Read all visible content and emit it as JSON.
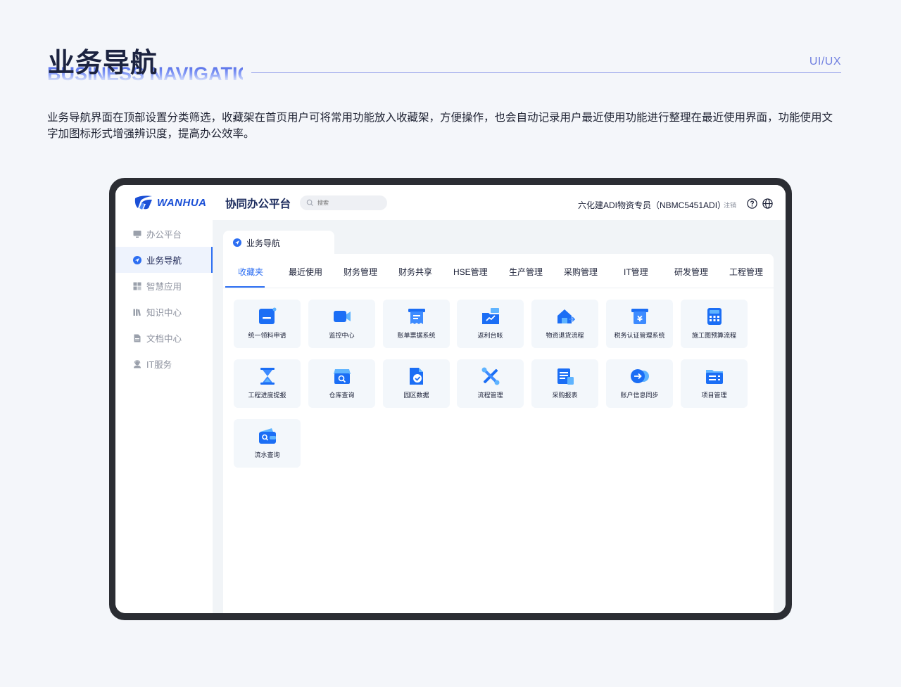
{
  "header": {
    "title": "业务导航",
    "subtitle": "BUSINESS NAVIGATIO",
    "tag": "UI/UX",
    "description": "业务导航界面在顶部设置分类筛选，收藏架在首页用户可将常用功能放入收藏架，方便操作，也会自动记录用户最近使用功能进行整理在最近使用界面，功能使用文字加图标形式增强辨识度，提高办公效率。"
  },
  "app": {
    "logo_text": "WANHUA",
    "platform_title": "协同办公平台",
    "search_placeholder": "搜索",
    "user": "六化建ADI物资专员（NBMC5451ADI）",
    "logout": "注销"
  },
  "sidebar": {
    "items": [
      {
        "label": "办公平台",
        "icon": "monitor-icon"
      },
      {
        "label": "业务导航",
        "icon": "navigation-icon",
        "active": true
      },
      {
        "label": "智慧应用",
        "icon": "apps-grid-icon"
      },
      {
        "label": "知识中心",
        "icon": "books-icon"
      },
      {
        "label": "文档中心",
        "icon": "document-icon"
      },
      {
        "label": "IT服务",
        "icon": "headset-icon"
      }
    ]
  },
  "content": {
    "tab_label": "业务导航",
    "categories": [
      "收藏夹",
      "最近使用",
      "财务管理",
      "财务共享",
      "HSE管理",
      "生产管理",
      "采购管理",
      "IT管理",
      "研发管理",
      "工程管理"
    ],
    "active_category": "收藏夹",
    "tiles": [
      {
        "label": "统一领料申请",
        "icon": "requisition-icon"
      },
      {
        "label": "监控中心",
        "icon": "camera-icon"
      },
      {
        "label": "账单票据系统",
        "icon": "receipt-icon"
      },
      {
        "label": "返利台帐",
        "icon": "rebate-folder-icon"
      },
      {
        "label": "物资退货流程",
        "icon": "return-goods-icon"
      },
      {
        "label": "税务认证管理系统",
        "icon": "tax-yen-icon"
      },
      {
        "label": "施工图预算流程",
        "icon": "calculator-icon"
      },
      {
        "label": "工程进度提报",
        "icon": "hourglass-icon"
      },
      {
        "label": "仓库查询",
        "icon": "warehouse-search-icon"
      },
      {
        "label": "园区数据",
        "icon": "park-data-icon"
      },
      {
        "label": "流程管理",
        "icon": "tools-icon"
      },
      {
        "label": "采购报表",
        "icon": "purchase-report-icon"
      },
      {
        "label": "账户信息同步",
        "icon": "account-sync-icon"
      },
      {
        "label": "项目管理",
        "icon": "project-folder-icon"
      },
      {
        "label": "流水查询",
        "icon": "wallet-search-icon"
      }
    ]
  },
  "colors": {
    "accent": "#2c6ef2",
    "icon_blue": "#1b6ef5",
    "icon_light": "#5fb4ff",
    "title_dark": "#1c2340",
    "device_frame": "#2b2d33"
  }
}
